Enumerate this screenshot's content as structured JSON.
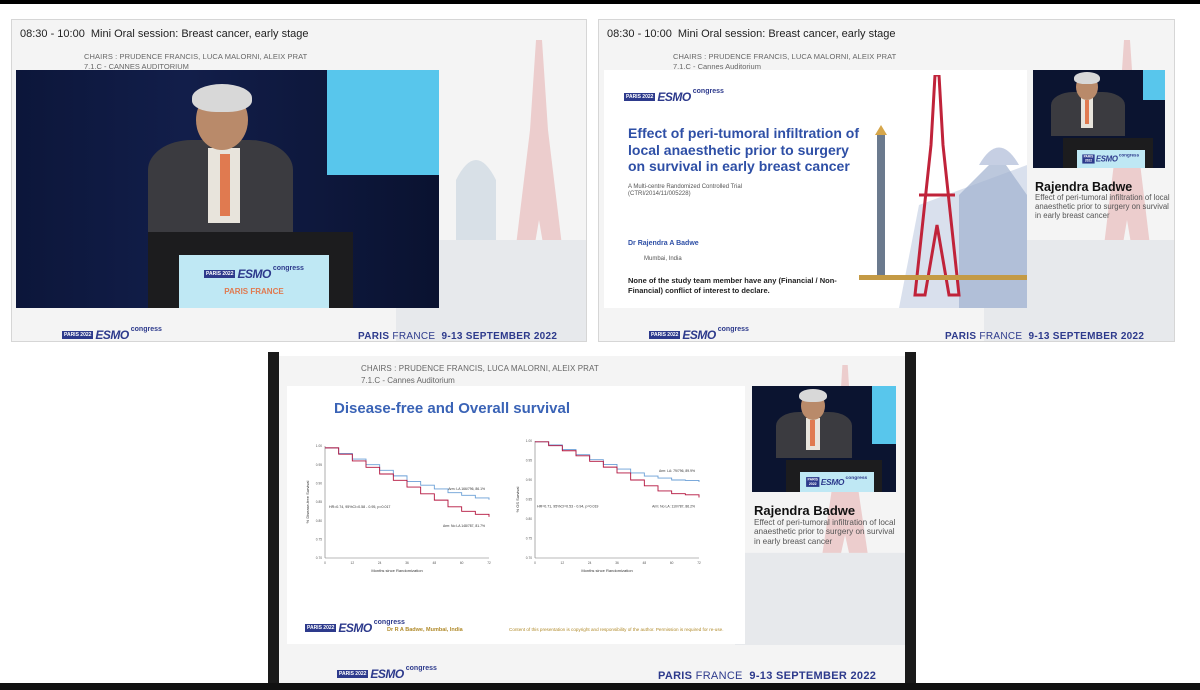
{
  "session": {
    "time": "08:30 - 10:00",
    "title": "Mini Oral session: Breast cancer, early stage",
    "chairs": "CHAIRS : PRUDENCE FRANCIS, LUCA MALORNI, ALEIX PRAT",
    "room_upper": "7.1.C - CANNES AUDITORIUM",
    "room_mixed": "7.1.C - Cannes Auditorium"
  },
  "branding": {
    "year_city": "PARIS 2022",
    "esmo": "ESMO",
    "congress": "congress",
    "paris": "PARIS",
    "france": "FRANCE",
    "dates": "9-13 SEPTEMBER 2022",
    "podium_city": "PARIS FRANCE",
    "brand_color": "#2d3a8c",
    "title_color": "#2e4fa6"
  },
  "speaker": {
    "name": "Rajendra Badwe",
    "talk": "Effect of peri-tumoral infiltration of local anaesthetic prior to surgery on survival in early breast cancer"
  },
  "title_slide": {
    "title": "Effect of peri-tumoral infiltration of local anaesthetic prior to surgery on survival in early breast cancer",
    "subtitle1": "A Multi-centre Randomized Controlled Trial",
    "subtitle2": "(CTRI/2014/11/005228)",
    "author": "Dr Rajendra A Badwe",
    "location": "Mumbai, India",
    "disclosure": "None of the study team member have any (Financial / Non-Financial)  conflict of interest to declare."
  },
  "results_slide": {
    "title": "Disease-free and Overall survival",
    "footer_author": "Dr R A Badwe, Mumbai, India",
    "copyright": "Content of this presentation is copyright and responsibility of the author. Permission is required for re-use."
  },
  "chart_data": [
    {
      "type": "line",
      "ylabel": "% Disease-free Survival",
      "xlabel": "Months since Randomization",
      "x_ticks": [
        "0",
        "12",
        "24",
        "36",
        "48",
        "60",
        "72"
      ],
      "y_ticks": [
        "1.00",
        "0.95",
        "0.90",
        "0.85",
        "0.80",
        "0.75",
        "0.70"
      ],
      "ylim": [
        0.7,
        1.0
      ],
      "xlim": [
        0,
        72
      ],
      "annotation": "HR=0.74, 95%CI=0.58 - 0.95, p=0.017",
      "series": [
        {
          "name": "Arm: LA 166/796, 86.1%",
          "color": "#6a9fd6",
          "x": [
            0,
            6,
            12,
            18,
            24,
            30,
            36,
            42,
            48,
            54,
            60,
            66,
            72
          ],
          "y": [
            0.995,
            0.98,
            0.965,
            0.95,
            0.935,
            0.92,
            0.905,
            0.895,
            0.885,
            0.875,
            0.868,
            0.861,
            0.856
          ]
        },
        {
          "name": "Arm: No LA 148/787, 81.7%",
          "color": "#b3123c",
          "x": [
            0,
            6,
            12,
            18,
            24,
            30,
            36,
            42,
            48,
            54,
            60,
            66,
            72
          ],
          "y": [
            0.995,
            0.978,
            0.96,
            0.943,
            0.925,
            0.908,
            0.89,
            0.872,
            0.855,
            0.837,
            0.825,
            0.817,
            0.81
          ]
        }
      ]
    },
    {
      "type": "line",
      "ylabel": "% OS Survival",
      "xlabel": "Months since Randomization",
      "x_ticks": [
        "0",
        "12",
        "24",
        "36",
        "48",
        "60",
        "72"
      ],
      "y_ticks": [
        "1.00",
        "0.95",
        "0.90",
        "0.85",
        "0.80",
        "0.75",
        "0.70"
      ],
      "ylim": [
        0.7,
        1.0
      ],
      "xlim": [
        0,
        72
      ],
      "annotation": "HR=0.71, 95%CI=0.53 - 0.94, p=0.019",
      "series": [
        {
          "name": "Arm: LA: 79/796, 89.9%",
          "color": "#6a9fd6",
          "x": [
            0,
            6,
            12,
            18,
            24,
            30,
            36,
            42,
            48,
            54,
            60,
            66,
            72
          ],
          "y": [
            0.998,
            0.99,
            0.978,
            0.965,
            0.952,
            0.94,
            0.928,
            0.918,
            0.91,
            0.905,
            0.9,
            0.899,
            0.895
          ]
        },
        {
          "name": "Arm: No LA: 110/787, 86.2%",
          "color": "#b3123c",
          "x": [
            0,
            6,
            12,
            18,
            24,
            30,
            36,
            42,
            48,
            54,
            60,
            66,
            72
          ],
          "y": [
            0.998,
            0.988,
            0.975,
            0.962,
            0.948,
            0.933,
            0.918,
            0.9,
            0.885,
            0.872,
            0.865,
            0.862,
            0.855
          ]
        }
      ]
    }
  ]
}
